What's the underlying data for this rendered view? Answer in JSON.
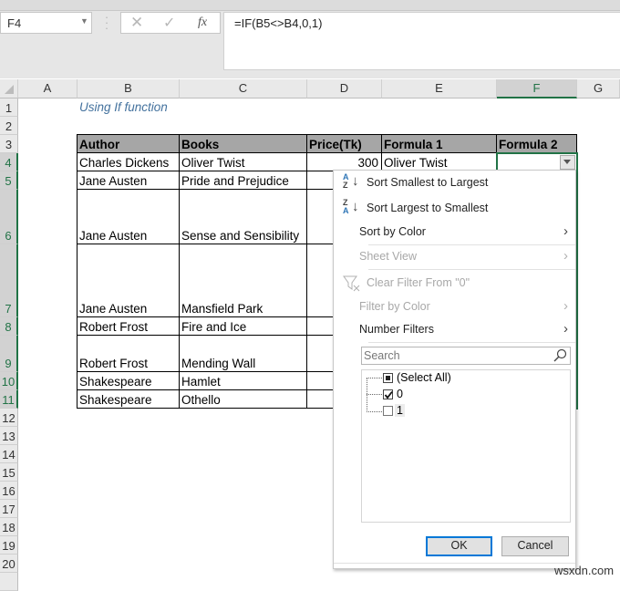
{
  "formula_bar": {
    "name_box": "F4",
    "formula": "=IF(B5<>B4,0,1)",
    "cancel_icon": "✕",
    "enter_icon": "✓",
    "fx_label": "fx"
  },
  "columns": [
    "A",
    "B",
    "C",
    "D",
    "E",
    "F",
    "G"
  ],
  "selected_column": "F",
  "rows": [
    "1",
    "2",
    "3",
    "4",
    "5",
    "6",
    "7",
    "8",
    "9",
    "10",
    "11",
    "12",
    "13",
    "14",
    "15",
    "16",
    "17",
    "18",
    "19",
    "20"
  ],
  "sheet": {
    "title": "Using If function",
    "headers": [
      "Author",
      "Books",
      "Price(Tk)",
      "Formula 1",
      "Formula 2"
    ],
    "data": [
      {
        "author": "Charles Dickens",
        "book": "Oliver Twist",
        "price": "300",
        "formula1": "Oliver Twist",
        "formula2": ""
      },
      {
        "author": "Jane Austen",
        "book": "Pride and Prejudice",
        "price": "",
        "formula1": "",
        "formula2": ""
      },
      {
        "author": "Jane Austen",
        "book": "Sense and Sensibility",
        "price": "",
        "formula1": "",
        "formula2": ""
      },
      {
        "author": "Jane Austen",
        "book": "Mansfield Park",
        "price": "",
        "formula1": "",
        "formula2": ""
      },
      {
        "author": "Robert Frost",
        "book": "Fire and Ice",
        "price": "",
        "formula1": "",
        "formula2": ""
      },
      {
        "author": "Robert Frost",
        "book": "Mending Wall",
        "price": "",
        "formula1": "",
        "formula2": ""
      },
      {
        "author": "Shakespeare",
        "book": "Hamlet",
        "price": "",
        "formula1": "",
        "formula2": ""
      },
      {
        "author": "Shakespeare",
        "book": "Othello",
        "price": "",
        "formula1": "",
        "formula2": ""
      }
    ]
  },
  "filter_menu": {
    "items": [
      {
        "label": "Sort Smallest to Largest",
        "icon": "sort-ascending-icon",
        "enabled": true
      },
      {
        "label": "Sort Largest to Smallest",
        "icon": "sort-descending-icon",
        "enabled": true
      },
      {
        "label": "Sort by Color",
        "enabled": true,
        "submenu": true
      },
      {
        "label": "Sheet View",
        "enabled": false,
        "submenu": true
      },
      {
        "label": "Clear Filter From \"0\"",
        "icon": "clear-filter-icon",
        "enabled": false
      },
      {
        "label": "Filter by Color",
        "enabled": false,
        "submenu": true
      },
      {
        "label": "Number Filters",
        "enabled": true,
        "submenu": true
      }
    ],
    "search_placeholder": "Search",
    "values": [
      {
        "label": "(Select All)",
        "state": "indeterminate"
      },
      {
        "label": "0",
        "state": "checked"
      },
      {
        "label": "1",
        "state": "unchecked"
      }
    ],
    "ok_label": "OK",
    "cancel_label": "Cancel"
  },
  "watermark": "wsxdn.com",
  "colors": {
    "accent_green": "#217346",
    "header_fill": "#a6a6a6",
    "title_blue": "#44729e",
    "ok_border": "#0078d7"
  }
}
